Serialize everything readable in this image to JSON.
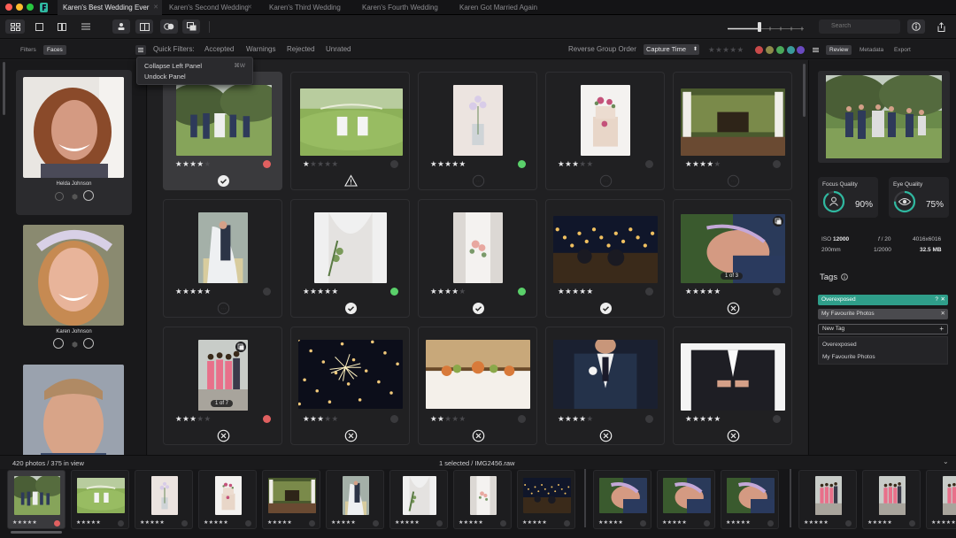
{
  "tabs": [
    {
      "label": "Karen's Best Wedding Ever",
      "active": true
    },
    {
      "label": "Karen's Second Wedding"
    },
    {
      "label": "Karen's Third Wedding"
    },
    {
      "label": "Karen's Fourth Wedding"
    },
    {
      "label": "Karen Got Married Again"
    }
  ],
  "toolbar": {
    "search_placeholder": "Search"
  },
  "left_panel": {
    "tabs": [
      "Filters",
      "Faces"
    ],
    "active_tab": "Faces",
    "faces": [
      {
        "name": "Helda Johnson"
      },
      {
        "name": "Karen Johnson"
      },
      {
        "name": ""
      }
    ]
  },
  "quick_filters": {
    "label": "Quick Filters:",
    "items": [
      "Accepted",
      "Warnings",
      "Rejected",
      "Unrated"
    ],
    "reverse_label": "Reverse Group Order",
    "sort_value": "Capture Time",
    "color_labels": [
      "#c94a4a",
      "#8a8a3a",
      "#4aa85a",
      "#3aa0a0",
      "#6a4ac0"
    ]
  },
  "context_menu": {
    "items": [
      {
        "label": "Collapse Left Panel",
        "shortcut": "⌘W"
      },
      {
        "label": "Undock Panel",
        "shortcut": ""
      }
    ]
  },
  "grid": [
    {
      "rating": 4,
      "dot": "#e06060",
      "status": "accept",
      "selected": true
    },
    {
      "rating": 1,
      "dot": "",
      "status": "warning"
    },
    {
      "rating": 5,
      "dot": "#5ad06a",
      "status": "none"
    },
    {
      "rating": 3,
      "dot": "",
      "status": "none"
    },
    {
      "rating": 4,
      "dot": "",
      "status": "none"
    },
    {
      "rating": 5,
      "dot": "",
      "status": "none"
    },
    {
      "rating": 5,
      "dot": "#5ad06a",
      "status": "accept"
    },
    {
      "rating": 4,
      "dot": "#5ad06a",
      "status": "accept"
    },
    {
      "rating": 5,
      "dot": "",
      "status": "accept"
    },
    {
      "rating": 5,
      "dot": "",
      "status": "reject",
      "badge": "1 of 3"
    },
    {
      "rating": 3,
      "dot": "#e06060",
      "status": "reject",
      "badge": "1 of 7"
    },
    {
      "rating": 3,
      "dot": "",
      "status": "reject"
    },
    {
      "rating": 2,
      "dot": "",
      "status": "reject"
    },
    {
      "rating": 4,
      "dot": "",
      "status": "reject"
    },
    {
      "rating": 5,
      "dot": "",
      "status": "reject"
    }
  ],
  "right_panel": {
    "tabs": [
      "Review",
      "Metadata",
      "Export"
    ],
    "active_tab": "Review",
    "focus_label": "Focus Quality",
    "focus_value": "90%",
    "focus_fraction": 0.9,
    "eye_label": "Eye Quality",
    "eye_value": "75%",
    "eye_fraction": 0.75,
    "iso_label": "ISO",
    "iso_value": "12000",
    "aperture_prefix": "f",
    "aperture_value": "/ 20",
    "dimensions": "4016x6016",
    "focal": "200mm",
    "shutter": "1/2000",
    "size_value": "32.5",
    "size_unit": "MB",
    "tags_title": "Tags",
    "tags": [
      {
        "label": "Overexposed",
        "color": "#2f9e8a",
        "mark": "?"
      },
      {
        "label": "My Favourite Photos",
        "color": "#4a4a4e",
        "mark": ""
      }
    ],
    "new_tag_label": "New Tag",
    "suggestions": [
      "Overexposed",
      "My Favourite Photos"
    ],
    "accent": "#2fb8a0"
  },
  "status_bar": {
    "count": "420 photos / 375 in view",
    "selected": "1 selected / IMG2456.raw"
  },
  "filmstrip": [
    {
      "rating": 4,
      "dot": "#e06060",
      "selected": true
    },
    {
      "rating": 1
    },
    {
      "rating": 5
    },
    {
      "rating": 3
    },
    {
      "rating": 4
    },
    {
      "rating": 5
    },
    {
      "rating": 5
    },
    {
      "rating": 4
    },
    {
      "rating": 5
    },
    {
      "rating": 5
    },
    {
      "rating": 5
    },
    {
      "rating": 3
    },
    {
      "rating": 3
    },
    {
      "rating": 3
    },
    {
      "rating": 2
    }
  ]
}
